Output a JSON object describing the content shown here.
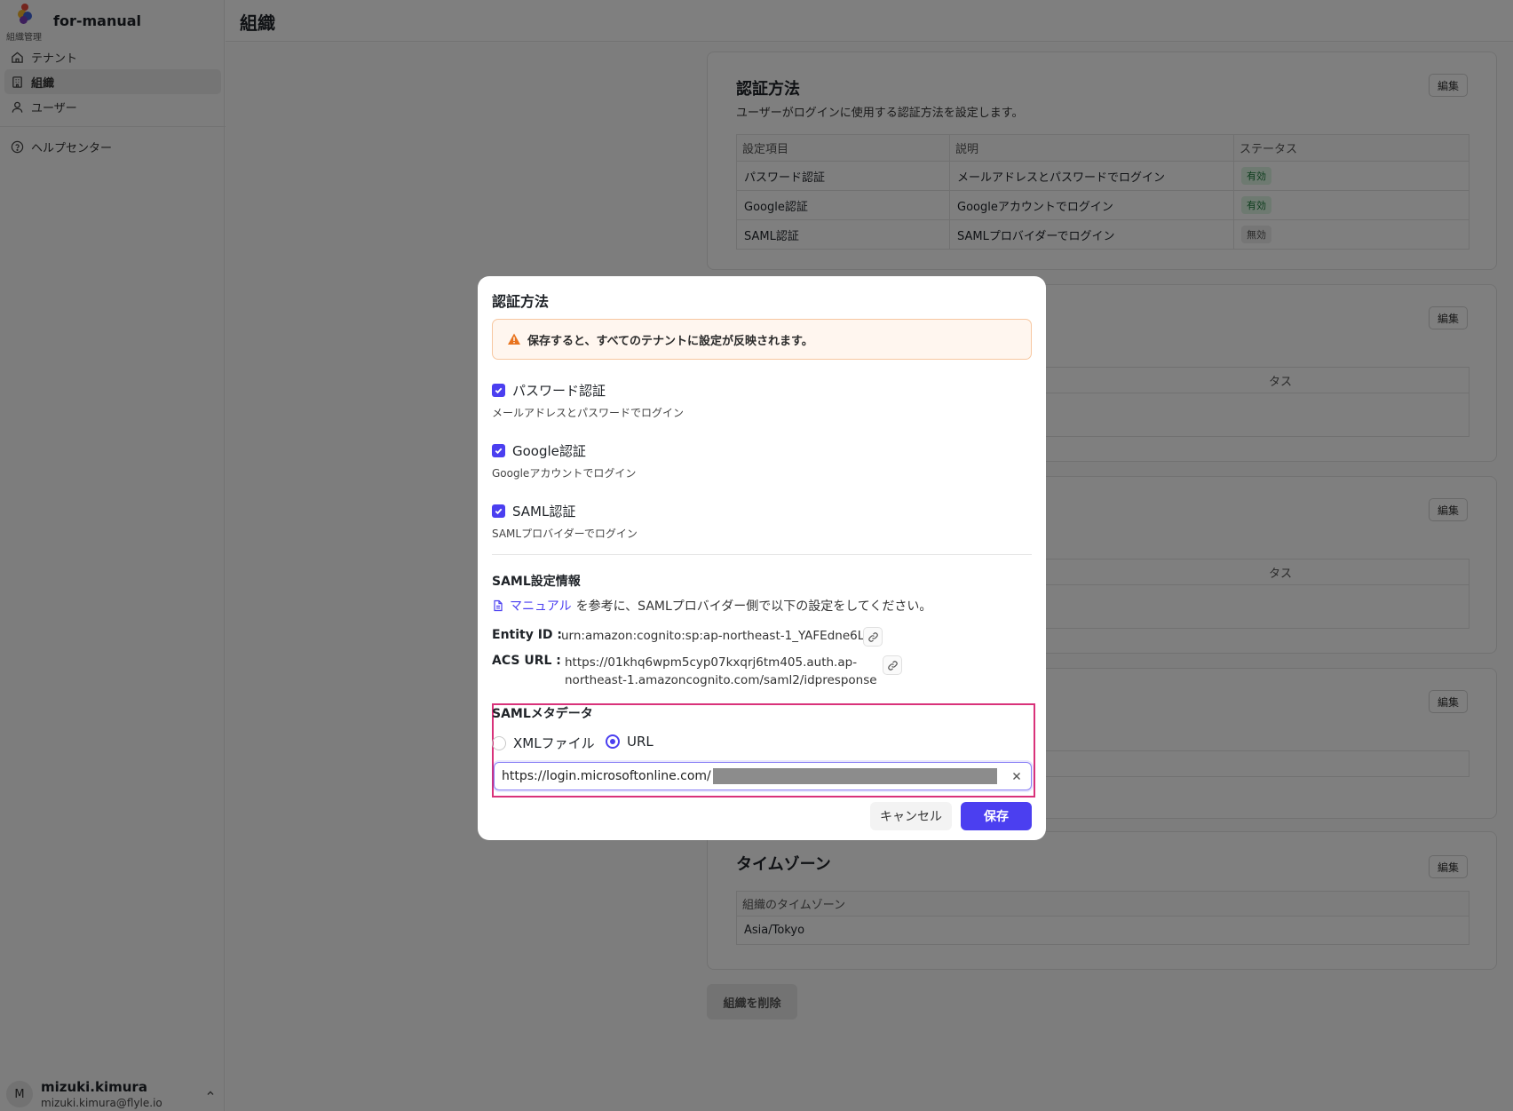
{
  "sidebar": {
    "brand_name": "for-manual",
    "brand_sub": "組織管理",
    "items": [
      {
        "label": "テナント",
        "icon": "home-icon"
      },
      {
        "label": "組織",
        "icon": "building-icon"
      },
      {
        "label": "ユーザー",
        "icon": "user-icon"
      }
    ],
    "help": {
      "label": "ヘルプセンター",
      "icon": "help-circle-icon"
    },
    "user": {
      "initial": "M",
      "name": "mizuki.kimura",
      "email": "mizuki.kimura@flyle.io"
    }
  },
  "header": {
    "title": "組織"
  },
  "auth_card": {
    "title": "認証方法",
    "description": "ユーザーがログインに使用する認証方法を設定します。",
    "edit_label": "編集",
    "columns": [
      "設定項目",
      "説明",
      "ステータス"
    ],
    "rows": [
      {
        "item": "パスワード認証",
        "desc": "メールアドレスとパスワードでログイン",
        "status": "有効"
      },
      {
        "item": "Google認証",
        "desc": "Googleアカウントでログイン",
        "status": "有効"
      },
      {
        "item": "SAML認証",
        "desc": "SAMLプロバイダーでログイン",
        "status": "無効"
      }
    ]
  },
  "background_cards": {
    "edit_label": "編集",
    "status_fragment": "タス"
  },
  "timezone_card": {
    "title": "タイムゾーン",
    "edit_label": "編集",
    "column": "組織のタイムゾーン",
    "value": "Asia/Tokyo"
  },
  "delete_button": "組織を削除",
  "modal": {
    "title": "認証方法",
    "warning": "保存すると、すべてのテナントに設定が反映されます。",
    "options": [
      {
        "label": "パスワード認証",
        "desc": "メールアドレスとパスワードでログイン",
        "checked": true
      },
      {
        "label": "Google認証",
        "desc": "Googleアカウントでログイン",
        "checked": true
      },
      {
        "label": "SAML認証",
        "desc": "SAMLプロバイダーでログイン",
        "checked": true
      }
    ],
    "saml_title": "SAML設定情報",
    "manual_link": "マニュアル",
    "manual_text": "を参考に、SAMLプロバイダー側で以下の設定をしてください。",
    "entity_label": "Entity ID :",
    "entity_value": "urn:amazon:cognito:sp:ap-northeast-1_YAFEdne6L",
    "acs_label": "ACS URL :",
    "acs_line1": "https://01khq6wpm5cyp07kxqrj6tm405.auth.ap-",
    "acs_line2": "northeast-1.amazoncognito.com/saml2/idpresponse",
    "metadata_title": "SAMLメタデータ",
    "radio_xml": "XMLファイル",
    "radio_url": "URL",
    "selected_radio": "URL",
    "url_value": "https://login.microsoftonline.com/",
    "cancel_label": "キャンセル",
    "save_label": "保存"
  },
  "colors": {
    "accent": "#4b3ff0",
    "highlight_border": "#d9327a",
    "warning_icon": "#e8731e"
  }
}
